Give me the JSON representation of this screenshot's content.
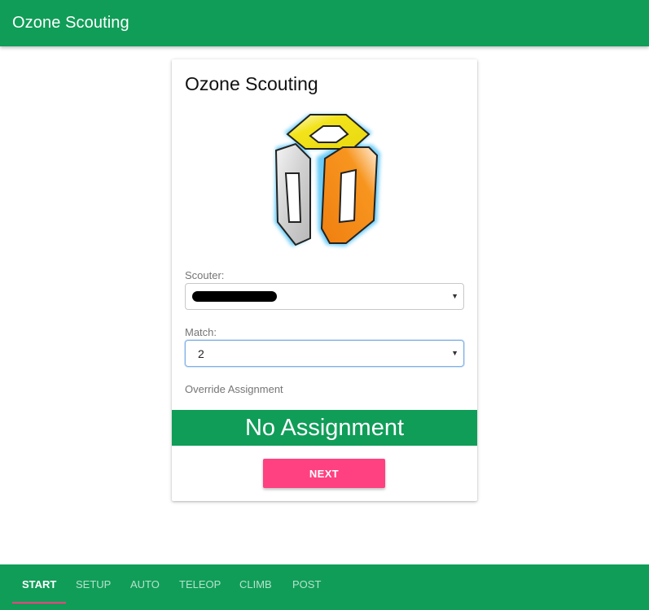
{
  "appbar": {
    "title": "Ozone Scouting"
  },
  "card": {
    "title": "Ozone Scouting",
    "scouter": {
      "label": "Scouter:",
      "value": ""
    },
    "match": {
      "label": "Match:",
      "value": "2"
    },
    "override_label": "Override Assignment",
    "assignment_banner": "No Assignment",
    "next_button": "NEXT"
  },
  "tabs": [
    {
      "label": "START",
      "active": true
    },
    {
      "label": "SETUP",
      "active": false
    },
    {
      "label": "AUTO",
      "active": false
    },
    {
      "label": "TELEOP",
      "active": false
    },
    {
      "label": "CLIMB",
      "active": false
    },
    {
      "label": "POST",
      "active": false
    }
  ],
  "colors": {
    "primary": "#109d58",
    "accent": "#ff4081",
    "logo_yellow": "#f0e020",
    "logo_gray": "#cfcfcf",
    "logo_orange": "#f5881f"
  },
  "icons": {
    "caret": "triangle-down-icon",
    "logo": "ozone-cube-logo"
  }
}
